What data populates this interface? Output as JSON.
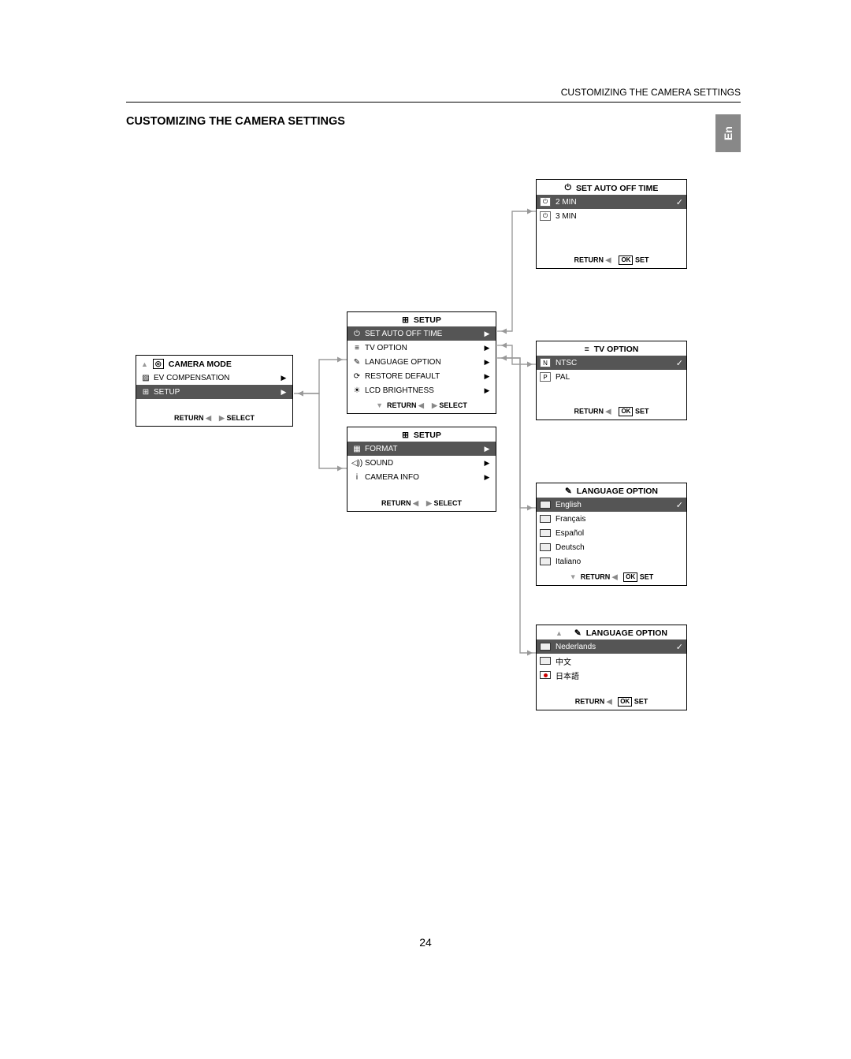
{
  "running_head": "CUSTOMIZING THE CAMERA SETTINGS",
  "section_title": "CUSTOMIZING THE CAMERA SETTINGS",
  "lang_tab": "En",
  "page_num": "24",
  "camera_mode": {
    "title_icon": "◎",
    "title": "CAMERA MODE",
    "top_marker": "▲",
    "items": [
      {
        "icon": "▨",
        "label": "EV COMPENSATION",
        "arrow": "▶",
        "sel": false
      },
      {
        "icon": "⊞",
        "label": "SETUP",
        "arrow": "▶",
        "sel": true
      }
    ],
    "footer": {
      "ret": "RETURN",
      "retk": "◀",
      "selk": "▶",
      "sel": "SELECT"
    }
  },
  "setup1": {
    "icon": "⊞",
    "title": "SETUP",
    "items": [
      {
        "icon": "⏻",
        "label": "SET AUTO OFF TIME",
        "arrow": "▶",
        "sel": true
      },
      {
        "icon": "≡",
        "label": "TV OPTION",
        "arrow": "▶",
        "sel": false
      },
      {
        "icon": "✎",
        "label": "LANGUAGE OPTION",
        "arrow": "▶",
        "sel": false
      },
      {
        "icon": "⟳",
        "label": "RESTORE DEFAULT",
        "arrow": "▶",
        "sel": false
      },
      {
        "icon": "☀",
        "label": "LCD BRIGHTNESS",
        "arrow": "▶",
        "sel": false
      }
    ],
    "footer": {
      "down": "▼",
      "ret": "RETURN",
      "retk": "◀",
      "selk": "▶",
      "sel": "SELECT"
    }
  },
  "setup2": {
    "icon": "⊞",
    "title": "SETUP",
    "items": [
      {
        "icon": "▦",
        "label": "FORMAT",
        "arrow": "▶",
        "sel": true
      },
      {
        "icon": "◁))",
        "label": "SOUND",
        "arrow": "▶",
        "sel": false
      },
      {
        "icon": "i",
        "label": "CAMERA INFO",
        "arrow": "▶",
        "sel": false
      }
    ],
    "footer": {
      "ret": "RETURN",
      "retk": "◀",
      "selk": "▶",
      "sel": "SELECT"
    }
  },
  "autooff": {
    "icon": "⏻",
    "title": "SET AUTO OFF TIME",
    "items": [
      {
        "icon": "⏻",
        "label": "2 MIN",
        "check": true,
        "sel": true
      },
      {
        "icon": "⏻",
        "label": "3 MIN",
        "check": false,
        "sel": false
      }
    ],
    "footer": {
      "ret": "RETURN",
      "retk": "◀",
      "ok": "OK",
      "set": "SET"
    }
  },
  "tvopt": {
    "icon": "≡",
    "title": "TV  OPTION",
    "items": [
      {
        "icon": "N",
        "label": "NTSC",
        "check": true,
        "sel": true
      },
      {
        "icon": "P",
        "label": "PAL",
        "check": false,
        "sel": false
      }
    ],
    "footer": {
      "ret": "RETURN",
      "retk": "◀",
      "ok": "OK",
      "set": "SET"
    }
  },
  "lang1": {
    "icon": "✎",
    "title": "LANGUAGE  OPTION",
    "items": [
      {
        "label": "English",
        "check": true,
        "sel": true
      },
      {
        "label": "Français",
        "check": false,
        "sel": false
      },
      {
        "label": "Español",
        "check": false,
        "sel": false
      },
      {
        "label": "Deutsch",
        "check": false,
        "sel": false
      },
      {
        "label": "Italiano",
        "check": false,
        "sel": false
      }
    ],
    "footer": {
      "down": "▼",
      "ret": "RETURN",
      "retk": "◀",
      "ok": "OK",
      "set": "SET"
    }
  },
  "lang2": {
    "icon": "✎",
    "title": "LANGUAGE  OPTION",
    "top_marker": "▲",
    "items": [
      {
        "label": "Nederlands",
        "check": true,
        "sel": true
      },
      {
        "label": "中文",
        "check": false,
        "sel": false
      },
      {
        "label": "日本語",
        "check": false,
        "sel": false
      }
    ],
    "footer": {
      "ret": "RETURN",
      "retk": "◀",
      "ok": "OK",
      "set": "SET"
    }
  }
}
